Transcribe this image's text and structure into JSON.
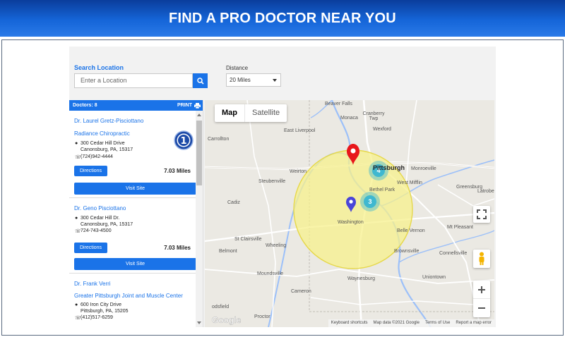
{
  "banner": {
    "title": "FIND A PRO DOCTOR NEAR YOU"
  },
  "search": {
    "label": "Search Location",
    "placeholder": "Enter a Location"
  },
  "distance": {
    "label": "Distance",
    "selected": "20 Miles"
  },
  "list": {
    "count_label": "Doctors: 8",
    "print_label": "PRINT",
    "doctors": [
      {
        "name": "Dr. Laurel Gretz-Pisciottano",
        "practice": "Radiance Chiropractic",
        "address1": "300 Cedar Hill Drive",
        "address2": "Canonsburg, PA, 15317",
        "phone": "(724)942-4444",
        "directions": "Directions",
        "miles": "7.03 Miles",
        "visit": "Visit Site",
        "badge": "1"
      },
      {
        "name": "Dr. Geno Pisciottano",
        "practice": "",
        "address1": "300 Cedar Hill Dr.",
        "address2": "Canonsburg, PA, 15317",
        "phone": "724-743-4500",
        "directions": "Directions",
        "miles": "7.03 Miles",
        "visit": "Visit Site"
      },
      {
        "name": "Dr. Frank Verri",
        "practice": "Greater Pittsburgh Joint and Muscle Center",
        "address1": "600 Iron City Drive",
        "address2": "Pittsburgh, PA, 15205",
        "phone": "(412)517-6259"
      }
    ]
  },
  "map": {
    "type_map": "Map",
    "type_satellite": "Satellite",
    "clusters": [
      "4",
      "3"
    ],
    "towns": [
      "Beaver Falls",
      "Monaca",
      "Cranberry Twp",
      "Wexford",
      "East Liverpool",
      "Carrollton",
      "Weirton",
      "Pittsburgh",
      "Monroeville",
      "Steubenville",
      "West Mifflin",
      "Bethel Park",
      "Greensburg",
      "Latrobe",
      "Cadiz",
      "Washington",
      "Belle Vernon",
      "Mt Pleasant",
      "St Clairsville",
      "Wheeling",
      "Belmont",
      "Brownsville",
      "Connellsville",
      "Moundsville",
      "Waynesburg",
      "Uniontown",
      "Cameron",
      "Proctor",
      "odsfield"
    ],
    "footer": {
      "shortcuts": "Keyboard shortcuts",
      "data": "Map data ©2021 Google",
      "terms": "Terms of Use",
      "report": "Report a map error"
    },
    "logo": "Google",
    "colors": {
      "radius_fill": "#f7f08c",
      "radius_stroke": "#e6d84a",
      "red_pin": "#e8171b",
      "blue_pin": "#4a45d8",
      "cluster": "#3fb8d0"
    }
  }
}
